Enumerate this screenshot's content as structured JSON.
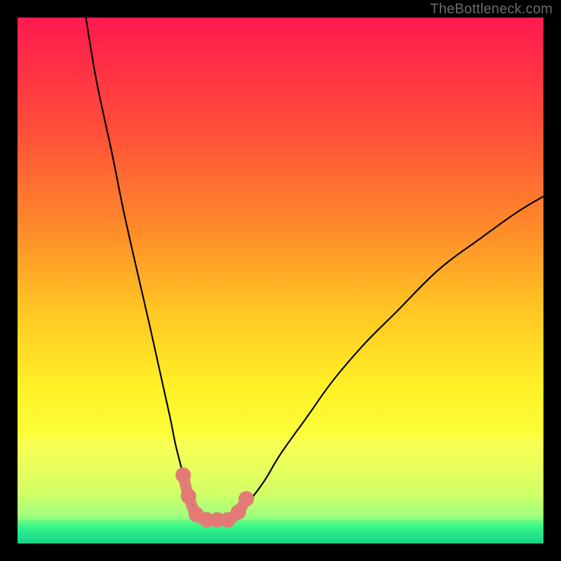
{
  "watermark": "TheBottleneck.com",
  "chart_data": {
    "type": "line",
    "title": "",
    "xlabel": "",
    "ylabel": "",
    "xlim": [
      0,
      100
    ],
    "ylim": [
      0,
      100
    ],
    "grid": false,
    "legend": false,
    "curve_left": {
      "name": "left-branch",
      "x": [
        13,
        15,
        18,
        20,
        22,
        25,
        27,
        29,
        30,
        31,
        32,
        33,
        34,
        35,
        36
      ],
      "y": [
        100,
        88,
        74,
        64,
        55,
        42,
        33,
        24,
        19,
        15,
        11,
        8,
        6,
        5,
        5
      ]
    },
    "curve_right": {
      "name": "right-branch",
      "x": [
        40,
        41,
        42,
        44,
        47,
        50,
        55,
        60,
        66,
        72,
        80,
        88,
        95,
        100
      ],
      "y": [
        5,
        5,
        6,
        8,
        12,
        17,
        24,
        31,
        38,
        44,
        52,
        58,
        63,
        66
      ]
    },
    "markers": {
      "name": "highlighted-points",
      "color": "#e37a76",
      "points": [
        {
          "x": 31.5,
          "y": 13
        },
        {
          "x": 32.5,
          "y": 9
        },
        {
          "x": 34.0,
          "y": 5.5
        },
        {
          "x": 36.0,
          "y": 4.5
        },
        {
          "x": 38.0,
          "y": 4.5
        },
        {
          "x": 40.0,
          "y": 4.5
        },
        {
          "x": 42.0,
          "y": 6
        },
        {
          "x": 43.5,
          "y": 8.5
        }
      ]
    },
    "gradient_stops": [
      {
        "offset": 0.0,
        "color": "#ff1a4f"
      },
      {
        "offset": 0.2,
        "color": "#ff4a3a"
      },
      {
        "offset": 0.4,
        "color": "#ff8a2a"
      },
      {
        "offset": 0.55,
        "color": "#ffc423"
      },
      {
        "offset": 0.7,
        "color": "#fff026"
      },
      {
        "offset": 0.8,
        "color": "#fbff3a"
      },
      {
        "offset": 0.9,
        "color": "#d4ff55"
      },
      {
        "offset": 0.945,
        "color": "#8fff74"
      },
      {
        "offset": 0.97,
        "color": "#34f58b"
      },
      {
        "offset": 1.0,
        "color": "#17d38a"
      }
    ],
    "background_band": {
      "y_top": 0.8,
      "y_bottom": 0.955,
      "color_top": "#fbff7a",
      "color_bottom": "#c6ff8a"
    }
  }
}
